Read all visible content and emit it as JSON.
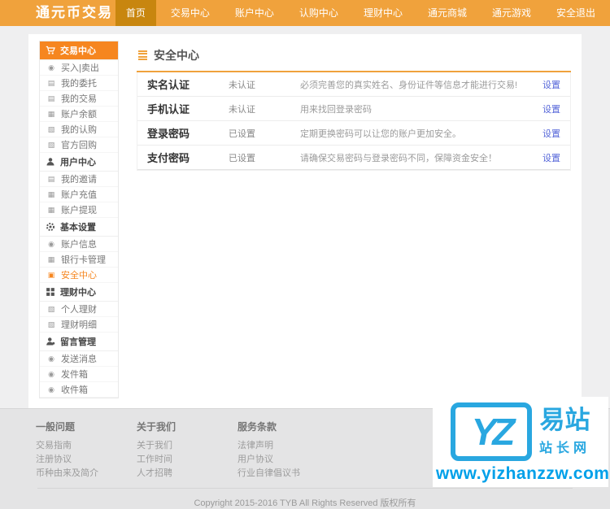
{
  "topbar": {
    "logo": "通元币交易",
    "nav": [
      {
        "label": "首页",
        "active": true
      },
      {
        "label": "交易中心",
        "active": false
      },
      {
        "label": "账户中心",
        "active": false
      },
      {
        "label": "认购中心",
        "active": false
      },
      {
        "label": "理财中心",
        "active": false
      },
      {
        "label": "通元商城",
        "active": false
      },
      {
        "label": "通元游戏",
        "active": false
      },
      {
        "label": "安全退出",
        "active": false
      }
    ]
  },
  "sidebar": {
    "active_item": "安全中心",
    "sections": [
      {
        "header": "交易中心",
        "header_icon": "cart-icon",
        "items": [
          {
            "label": "买入|卖出",
            "icon": "coin-icon",
            "glyph": "◉"
          },
          {
            "label": "我的委托",
            "icon": "list-icon",
            "glyph": "▤"
          },
          {
            "label": "我的交易",
            "icon": "document-icon",
            "glyph": "▤"
          },
          {
            "label": "账户余额",
            "icon": "wallet-icon",
            "glyph": "▦"
          },
          {
            "label": "我的认购",
            "icon": "chart-icon",
            "glyph": "▧"
          },
          {
            "label": "官方回购",
            "icon": "chart-icon",
            "glyph": "▧"
          }
        ]
      },
      {
        "header": "用户中心",
        "header_icon": "user-icon",
        "items": [
          {
            "label": "我的邀请",
            "icon": "document-icon",
            "glyph": "▤"
          },
          {
            "label": "账户充值",
            "icon": "card-icon",
            "glyph": "▦"
          },
          {
            "label": "账户提现",
            "icon": "card-icon",
            "glyph": "▦"
          }
        ]
      },
      {
        "header": "基本设置",
        "header_icon": "gear-icon",
        "items": [
          {
            "label": "账户信息",
            "icon": "profile-icon",
            "glyph": "◉"
          },
          {
            "label": "银行卡管理",
            "icon": "bank-card-icon",
            "glyph": "▦"
          },
          {
            "label": "安全中心",
            "icon": "lock-icon",
            "glyph": "▣"
          }
        ]
      },
      {
        "header": "理财中心",
        "header_icon": "grid-icon",
        "items": [
          {
            "label": "个人理财",
            "icon": "chart-icon",
            "glyph": "▧"
          },
          {
            "label": "理财明细",
            "icon": "chart-icon",
            "glyph": "▧"
          }
        ]
      },
      {
        "header": "留言管理",
        "header_icon": "chat-user-icon",
        "items": [
          {
            "label": "发送消息",
            "icon": "message-icon",
            "glyph": "◉"
          },
          {
            "label": "发件箱",
            "icon": "outbox-icon",
            "glyph": "◉"
          },
          {
            "label": "收件箱",
            "icon": "inbox-icon",
            "glyph": "◉"
          }
        ]
      }
    ]
  },
  "content": {
    "title": "安全中心",
    "rows": [
      {
        "label": "实名认证",
        "status": "未认证",
        "desc": "必须完善您的真实姓名、身份证件等信息才能进行交易!",
        "action": "设置"
      },
      {
        "label": "手机认证",
        "status": "未认证",
        "desc": "用来找回登录密码",
        "action": "设置"
      },
      {
        "label": "登录密码",
        "status": "已设置",
        "desc": "定期更换密码可以让您的账户更加安全。",
        "action": "设置"
      },
      {
        "label": "支付密码",
        "status": "已设置",
        "desc": "请确保交易密码与登录密码不同，保障资金安全！",
        "action": "设置"
      }
    ]
  },
  "footer": {
    "columns": [
      {
        "heading": "一般问题",
        "links": [
          "交易指南",
          "注册协议",
          "币种由来及简介"
        ]
      },
      {
        "heading": "关于我们",
        "links": [
          "关于我们",
          "工作时间",
          "人才招聘"
        ]
      },
      {
        "heading": "服务条款",
        "links": [
          "法律声明",
          "用户协议",
          "行业自律倡议书"
        ]
      }
    ],
    "copyright": "Copyright 2015-2016 TYB All Rights Reserved 版权所有"
  },
  "watermark": {
    "logo_text": "YZ",
    "brand_line1": "易站",
    "brand_line2": "站长网",
    "url": "www.yizhanzzw.com"
  },
  "colors": {
    "topbar_orange": "#f0a23c",
    "topbar_active": "#c8860f",
    "sidebar_orange": "#f6861f",
    "link_blue": "#5566d9",
    "watermark_blue": "#29a7e0",
    "watermark_url_blue": "#00a0e9"
  }
}
